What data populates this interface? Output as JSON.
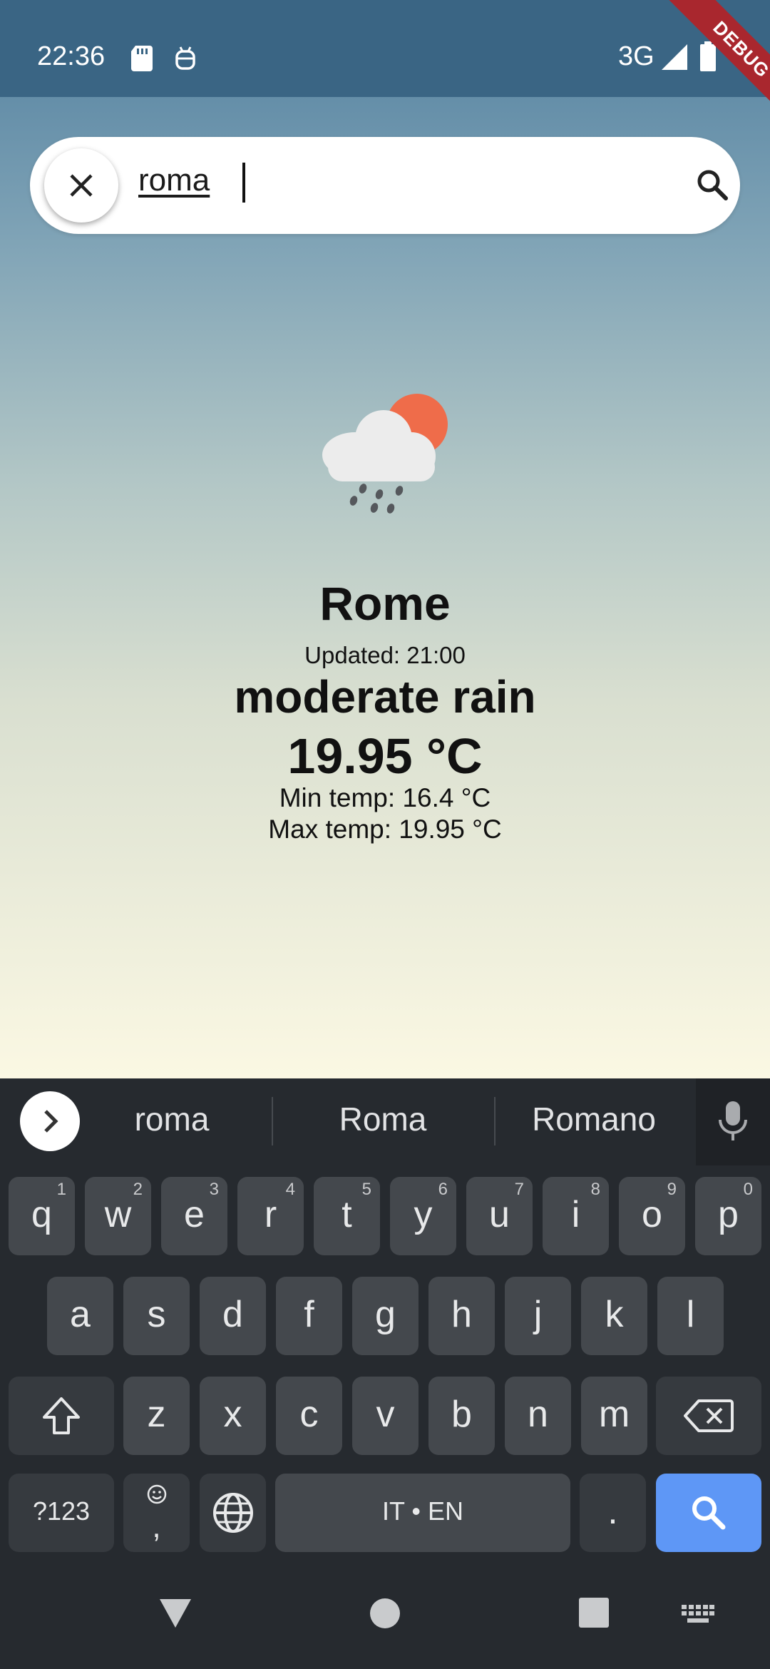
{
  "status_bar": {
    "time": "22:36",
    "network": "3G",
    "debug_label": "DEBUG"
  },
  "search": {
    "value": "roma"
  },
  "weather": {
    "icon": "rain-cloud-sun-icon",
    "city": "Rome",
    "updated": "Updated: 21:00",
    "description": "moderate rain",
    "temperature": "19.95 °C",
    "min_temp": "Min temp: 16.4 °C",
    "max_temp": "Max temp: 19.95 °C"
  },
  "keyboard": {
    "suggestions": [
      "roma",
      "Roma",
      "Romano"
    ],
    "row1": [
      {
        "k": "q",
        "h": "1"
      },
      {
        "k": "w",
        "h": "2"
      },
      {
        "k": "e",
        "h": "3"
      },
      {
        "k": "r",
        "h": "4"
      },
      {
        "k": "t",
        "h": "5"
      },
      {
        "k": "y",
        "h": "6"
      },
      {
        "k": "u",
        "h": "7"
      },
      {
        "k": "i",
        "h": "8"
      },
      {
        "k": "o",
        "h": "9"
      },
      {
        "k": "p",
        "h": "0"
      }
    ],
    "row2": [
      "a",
      "s",
      "d",
      "f",
      "g",
      "h",
      "j",
      "k",
      "l"
    ],
    "row3": [
      "z",
      "x",
      "c",
      "v",
      "b",
      "n",
      "m"
    ],
    "symbols_key": "?123",
    "comma_key": ",",
    "space_label": "IT • EN",
    "period_key": "."
  },
  "colors": {
    "accent": "#5e97f6",
    "status_bar": "#3a6584",
    "debug_banner": "#a9272e"
  }
}
